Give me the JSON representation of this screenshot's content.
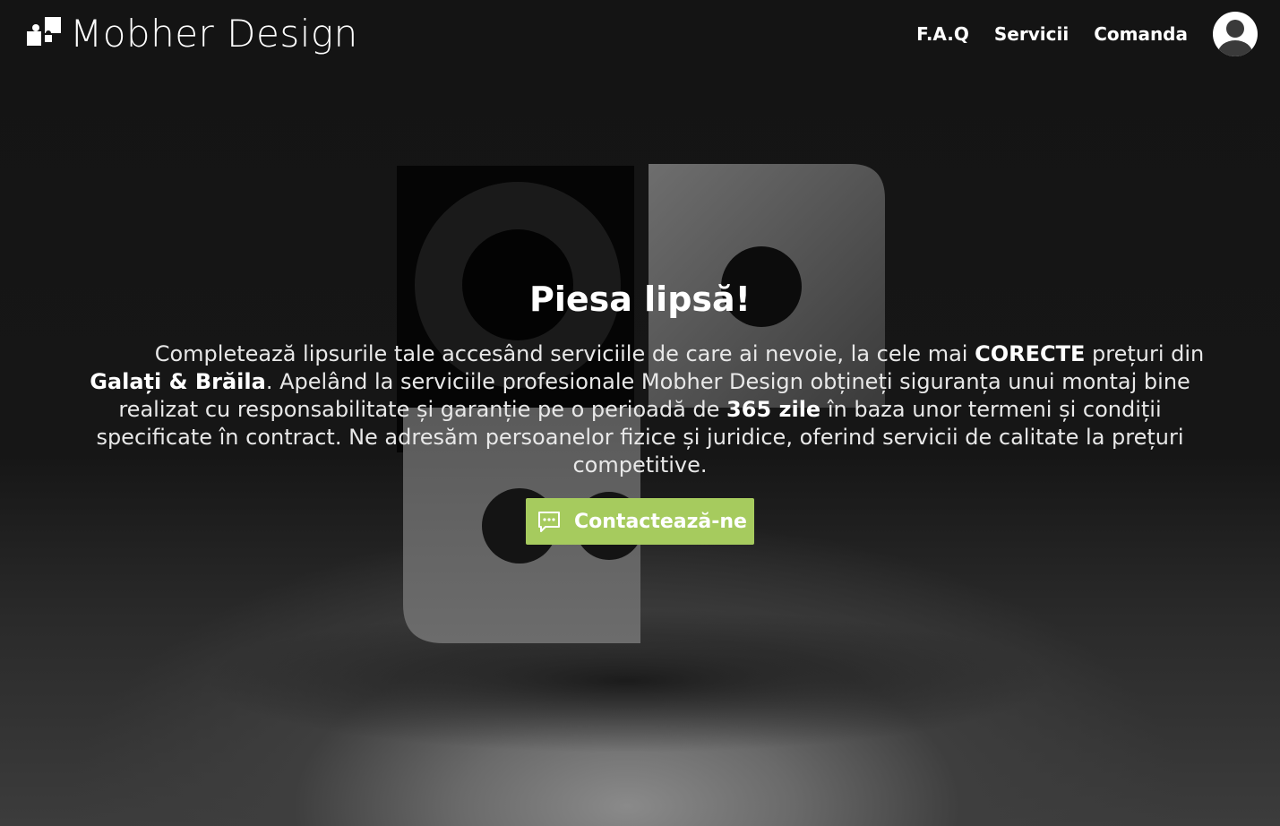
{
  "brand": {
    "name": "Mobher Design"
  },
  "nav": {
    "items": [
      {
        "label": "F.A.Q"
      },
      {
        "label": "Servicii"
      },
      {
        "label": "Comanda"
      }
    ]
  },
  "hero": {
    "title": "Piesa lipsă!",
    "text_parts": [
      "Completează lipsurile tale accesând serviciile de care ai nevoie, la cele mai ",
      "CORECTE",
      " prețuri din ",
      "Galați & Brăila",
      ". Apelând la serviciile profesionale Mobher Design obțineți siguranța unui montaj bine realizat cu responsabilitate și garanție pe o perioadă de ",
      "365 zile",
      " în baza unor termeni și condiții specificate în contract. Ne adresăm persoanelor fizice și juridice, oferind servicii de calitate la prețuri competitive."
    ],
    "cta_label": "Contactează-ne",
    "cta_icon": "chat-message-icon"
  },
  "icons": {
    "logo": "puzzle-logo-icon",
    "avatar": "user-avatar-icon"
  },
  "colors": {
    "accent": "#a6cb5e",
    "background": "#141414",
    "text": "#ffffff"
  }
}
